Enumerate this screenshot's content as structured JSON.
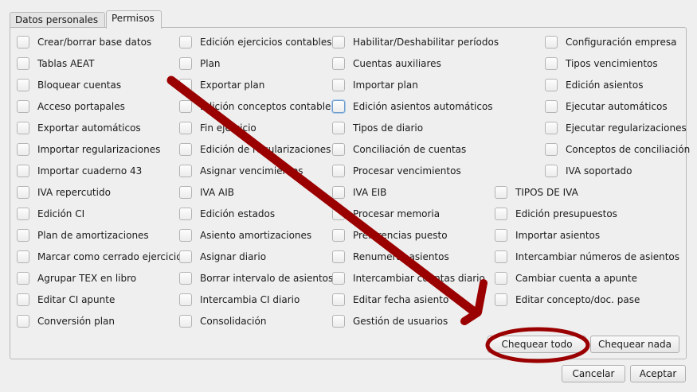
{
  "tabs": [
    {
      "label": "Datos personales"
    },
    {
      "label": "Permisos"
    }
  ],
  "permissions": {
    "col1": [
      "Crear/borrar base datos",
      "Tablas AEAT",
      "Bloquear cuentas",
      "Acceso portapales",
      "Exportar automáticos",
      "Importar regularizaciones",
      "Importar cuaderno 43",
      "IVA repercutido",
      "Edición CI",
      "Plan de amortizaciones",
      "Marcar como cerrado ejercicio",
      "Agrupar TEX en libro",
      "Editar CI apunte",
      "Conversión plan"
    ],
    "col2": [
      "Edición ejercicios contables",
      "Plan",
      "Exportar plan",
      "Edición conceptos contables",
      "Fin ejercicio",
      "Edición de regularizaciones",
      "Asignar vencimientos",
      "IVA AIB",
      "Edición estados",
      "Asiento amortizaciones",
      "Asignar diario",
      "Borrar intervalo de asientos",
      "Intercambia CI diario",
      "Consolidación"
    ],
    "col3": [
      "Habilitar/Deshabilitar períodos",
      "Cuentas auxiliares",
      "Importar plan",
      "Edición asientos automáticos",
      "Tipos de diario",
      "Conciliación de cuentas",
      "Procesar vencimientos",
      "IVA EIB",
      "Procesar memoria",
      "Preferencias puesto",
      "Renumerar asientos",
      "Intercambiar cuentas diario",
      "Editar fecha asiento",
      "Gestión de usuarios"
    ],
    "col4a": [
      "Configuración empresa",
      "Tipos vencimientos",
      "Edición asientos",
      "Ejecutar automáticos",
      "Ejecutar regularizaciones",
      "Conceptos de conciliación",
      "IVA soportado"
    ],
    "col4b": [
      "TIPOS DE IVA",
      "Edición presupuestos",
      "Importar asientos",
      "Intercambiar números de asientos",
      "Cambiar cuenta a apunte",
      "Editar concepto/doc. pase"
    ]
  },
  "buttons": {
    "check_all": "Chequear todo",
    "check_none": "Chequear nada",
    "cancel": "Cancelar",
    "accept": "Aceptar"
  },
  "colors": {
    "annotation_red": "#9b0000",
    "focus_blue": "#6e9ccc"
  }
}
